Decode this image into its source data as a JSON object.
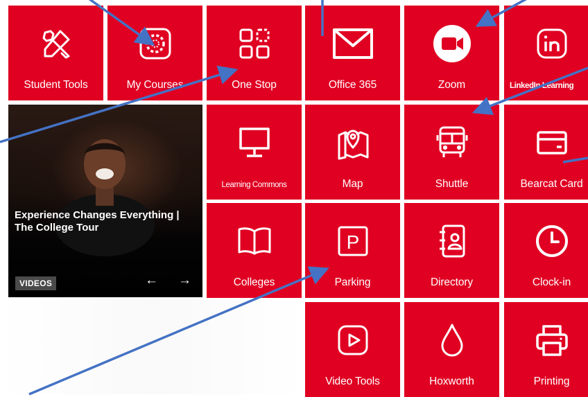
{
  "tiles": {
    "student_tools": "Student Tools",
    "my_courses": "My Courses",
    "one_stop": "One Stop",
    "office365": "Office 365",
    "zoom": "Zoom",
    "linkedin": "LinkedIn Learning",
    "learning_commons": "Learning Commons",
    "map": "Map",
    "shuttle": "Shuttle",
    "bearcat_card": "Bearcat Card",
    "colleges": "Colleges",
    "parking": "Parking",
    "directory": "Directory",
    "clock_in": "Clock-in",
    "video_tools": "Video Tools",
    "hoxworth": "Hoxworth",
    "printing": "Printing"
  },
  "video": {
    "title": "Experience Changes Everything | The College Tour",
    "badge": "VIDEOS",
    "prev": "←",
    "next": "→"
  },
  "colors": {
    "tile_red": "#E00122",
    "annotation_arrow": "#4472C4",
    "badge_gray": "#4a4a4a"
  },
  "icons": {
    "student_tools": "tools-icon",
    "my_courses": "canvas-icon",
    "one_stop": "grid-icon",
    "office365": "envelope-icon",
    "zoom": "video-camera-icon",
    "linkedin": "linkedin-icon",
    "learning_commons": "monitor-icon",
    "map": "map-pin-icon",
    "shuttle": "bus-icon",
    "bearcat_card": "credit-card-icon",
    "colleges": "book-icon",
    "parking": "parking-icon",
    "directory": "contact-book-icon",
    "clock_in": "clock-icon",
    "video_tools": "play-icon",
    "hoxworth": "blood-drop-icon",
    "printing": "printer-icon"
  }
}
